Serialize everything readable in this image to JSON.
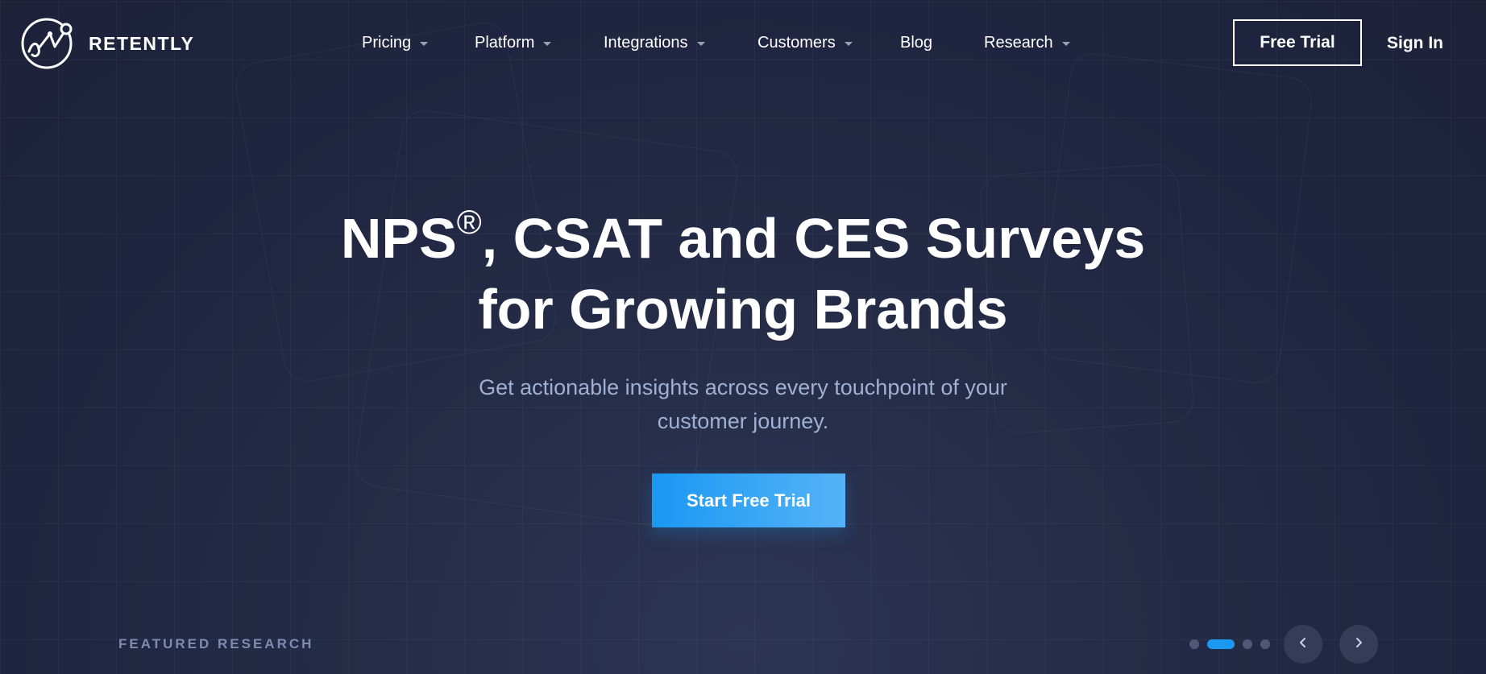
{
  "brand": {
    "name": "RETENTLY",
    "logo_icon": "retently-logo-icon"
  },
  "nav": {
    "items": [
      {
        "label": "Pricing",
        "has_dropdown": true
      },
      {
        "label": "Platform",
        "has_dropdown": true
      },
      {
        "label": "Integrations",
        "has_dropdown": true
      },
      {
        "label": "Customers",
        "has_dropdown": true
      },
      {
        "label": "Blog",
        "has_dropdown": false
      },
      {
        "label": "Research",
        "has_dropdown": true
      }
    ],
    "free_trial_label": "Free Trial",
    "sign_in_label": "Sign In"
  },
  "hero": {
    "title_line1_a": "NPS",
    "title_sup": "®",
    "title_line1_b": ", CSAT and CES Surveys",
    "title_line2": "for Growing Brands",
    "subtitle_line1": "Get actionable insights across every touchpoint of your",
    "subtitle_line2": "customer journey.",
    "cta_label": "Start Free Trial"
  },
  "featured": {
    "label": "FEATURED RESEARCH",
    "slides_total": 4,
    "active_slide": 2
  },
  "colors": {
    "background": "#1f2540",
    "accent": "#1a98f2",
    "subtitle": "#9fb0d3",
    "muted": "#7d8db1"
  }
}
